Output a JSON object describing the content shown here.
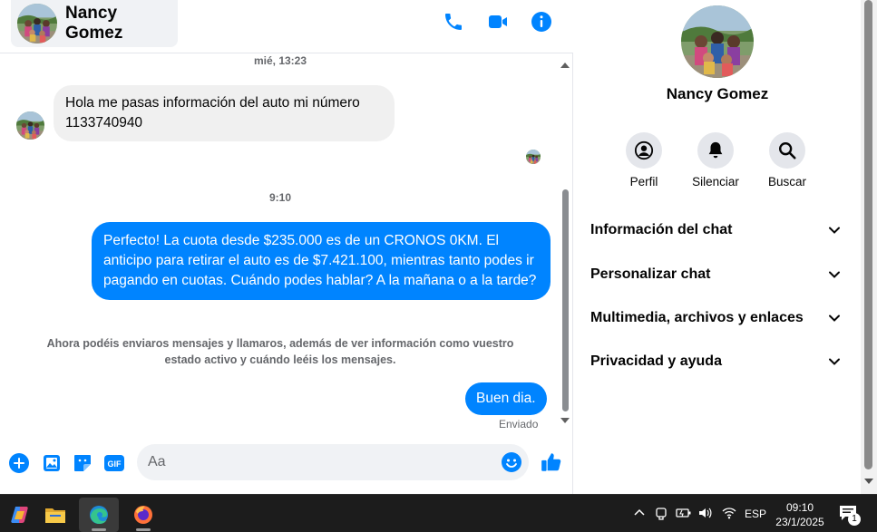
{
  "contact": {
    "name": "Nancy Gomez"
  },
  "colors": {
    "accent": "#0084ff",
    "bubble_in": "#f0f0f0",
    "meta": "#65676b"
  },
  "header": {
    "icons": [
      "phone-icon",
      "video-camera-icon",
      "info-icon"
    ]
  },
  "messages": {
    "timestamp1": "mié, 13:23",
    "incoming": "Hola me pasas información del auto mi número 1133740940",
    "timestamp2": "9:10",
    "outgoing1": "Perfecto! La cuota desde $235.000 es de un CRONOS 0KM. El anticipo para retirar el auto es de $7.421.100, mientras tanto podes ir pagando en cuotas. Cuándo podes hablar? A la mañana o a la tarde?",
    "system_note": "Ahora podéis enviaros mensajes y llamaros, además de ver información como vuestro estado activo y cuándo leéis los mensajes.",
    "outgoing2": "Buen dia.",
    "status": "Enviado"
  },
  "composer": {
    "placeholder": "Aa",
    "icons": [
      "add-circle-icon",
      "image-icon",
      "sticker-icon",
      "gif-icon",
      "emoji-icon",
      "thumbs-up-icon"
    ]
  },
  "info_panel": {
    "name": "Nancy Gomez",
    "actions": [
      {
        "label": "Perfil",
        "icon": "profile-icon"
      },
      {
        "label": "Silenciar",
        "icon": "bell-icon"
      },
      {
        "label": "Buscar",
        "icon": "search-icon"
      }
    ],
    "sections": [
      "Información del chat",
      "Personalizar chat",
      "Multimedia, archivos y enlaces",
      "Privacidad y ayuda"
    ]
  },
  "taskbar": {
    "apps": [
      "copilot-icon",
      "file-explorer-icon",
      "edge-icon",
      "firefox-icon"
    ],
    "language": "ESP",
    "time": "09:10",
    "date": "23/1/2025",
    "notification_count": "1"
  }
}
